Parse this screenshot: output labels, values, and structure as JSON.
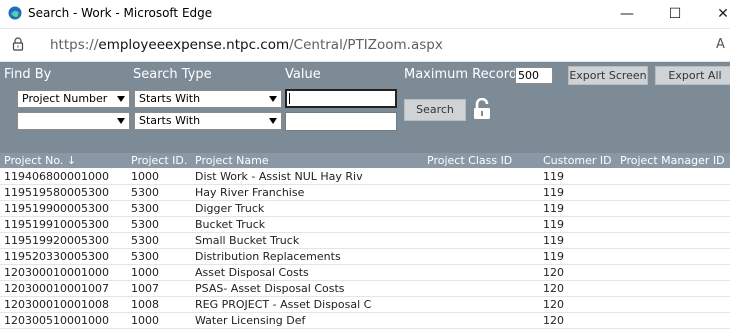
{
  "window": {
    "title": "Search - Work - Microsoft Edge",
    "minimize": "—",
    "maximize": "☐",
    "close": "✕"
  },
  "address": {
    "scheme": "https://",
    "host": "employeeexpense.ntpc.com",
    "path": "/Central/PTIZoom.aspx",
    "reader": "A"
  },
  "search": {
    "find_by_label": "Find By",
    "search_type_label": "Search Type",
    "value_label": "Value",
    "max_records_label": "Maximum Records:",
    "max_records_value": "500",
    "export_screen_label": "Export Screen",
    "export_all_label": "Export All",
    "search_button_label": "Search",
    "row1": {
      "find_by": "Project Number",
      "search_type": "Starts With",
      "value": ""
    },
    "row2": {
      "find_by": "",
      "search_type": "Starts With",
      "value": ""
    }
  },
  "table": {
    "headers": {
      "project_no": "Project No. ↓",
      "project_id": "Project ID.",
      "project_name": "Project Name",
      "project_class_id": "Project Class ID",
      "customer_id": "Customer ID",
      "project_manager_id": "Project Manager ID"
    },
    "rows": [
      {
        "project_no": "119406800001000",
        "project_id": "1000",
        "project_name": "Dist Work - Assist NUL Hay Riv",
        "customer_id": "119"
      },
      {
        "project_no": "119519580005300",
        "project_id": "5300",
        "project_name": "Hay River Franchise",
        "customer_id": "119"
      },
      {
        "project_no": "119519900005300",
        "project_id": "5300",
        "project_name": "Digger Truck",
        "customer_id": "119"
      },
      {
        "project_no": "119519910005300",
        "project_id": "5300",
        "project_name": "Bucket Truck",
        "customer_id": "119"
      },
      {
        "project_no": "119519920005300",
        "project_id": "5300",
        "project_name": "Small Bucket Truck",
        "customer_id": "119"
      },
      {
        "project_no": "119520330005300",
        "project_id": "5300",
        "project_name": "Distribution Replacements",
        "customer_id": "119"
      },
      {
        "project_no": "120300010001000",
        "project_id": "1000",
        "project_name": "Asset Disposal Costs",
        "customer_id": "120"
      },
      {
        "project_no": "120300010001007",
        "project_id": "1007",
        "project_name": "PSAS- Asset Disposal Costs",
        "customer_id": "120"
      },
      {
        "project_no": "120300010001008",
        "project_id": "1008",
        "project_name": "REG PROJECT - Asset Disposal C",
        "customer_id": "120"
      },
      {
        "project_no": "120300510001000",
        "project_id": "1000",
        "project_name": "Water Licensing Def",
        "customer_id": "120"
      }
    ]
  },
  "icons": {
    "app": "edge-icon",
    "lock": "padlock-icon",
    "unlock": "unlock-icon"
  }
}
